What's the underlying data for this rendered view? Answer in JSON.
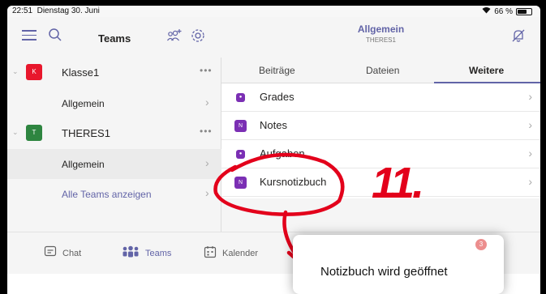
{
  "statusbar": {
    "time": "22:51",
    "date": "Dienstag 30. Juni",
    "battery": "66 %",
    "battery_level": 0.66
  },
  "sidebar": {
    "title": "Teams",
    "teams": [
      {
        "name": "Klasse1",
        "initial": "K",
        "color": "#e8172c",
        "more": "•••",
        "channels": [
          {
            "label": "Allgemein"
          }
        ]
      },
      {
        "name": "THERES1",
        "initial": "T",
        "color": "#2e8540",
        "more": "•••",
        "channels": [
          {
            "label": "Allgemein"
          }
        ]
      }
    ],
    "all_teams_link": "Alle Teams anzeigen"
  },
  "channel": {
    "title": "Allgemein",
    "subtitle": "THERES1",
    "tabs": [
      "Beiträge",
      "Dateien",
      "Weitere"
    ],
    "apps": [
      {
        "label": "Grades",
        "icon": "grades-icon"
      },
      {
        "label": "Notes",
        "icon": "onenote-icon"
      },
      {
        "label": "Aufgaben",
        "icon": "assignments-icon"
      },
      {
        "label": "Kursnotizbuch",
        "icon": "onenote-icon"
      }
    ]
  },
  "tabbar": {
    "chat": "Chat",
    "teams": "Teams",
    "calendar": "Kalender"
  },
  "annotation": {
    "step": "11."
  },
  "toast": {
    "message": "Notizbuch wird geöffnet",
    "badge": "3"
  },
  "colors": {
    "accent": "#6264a7",
    "annotation": "#e3001b",
    "onenote": "#7b2fb4"
  }
}
